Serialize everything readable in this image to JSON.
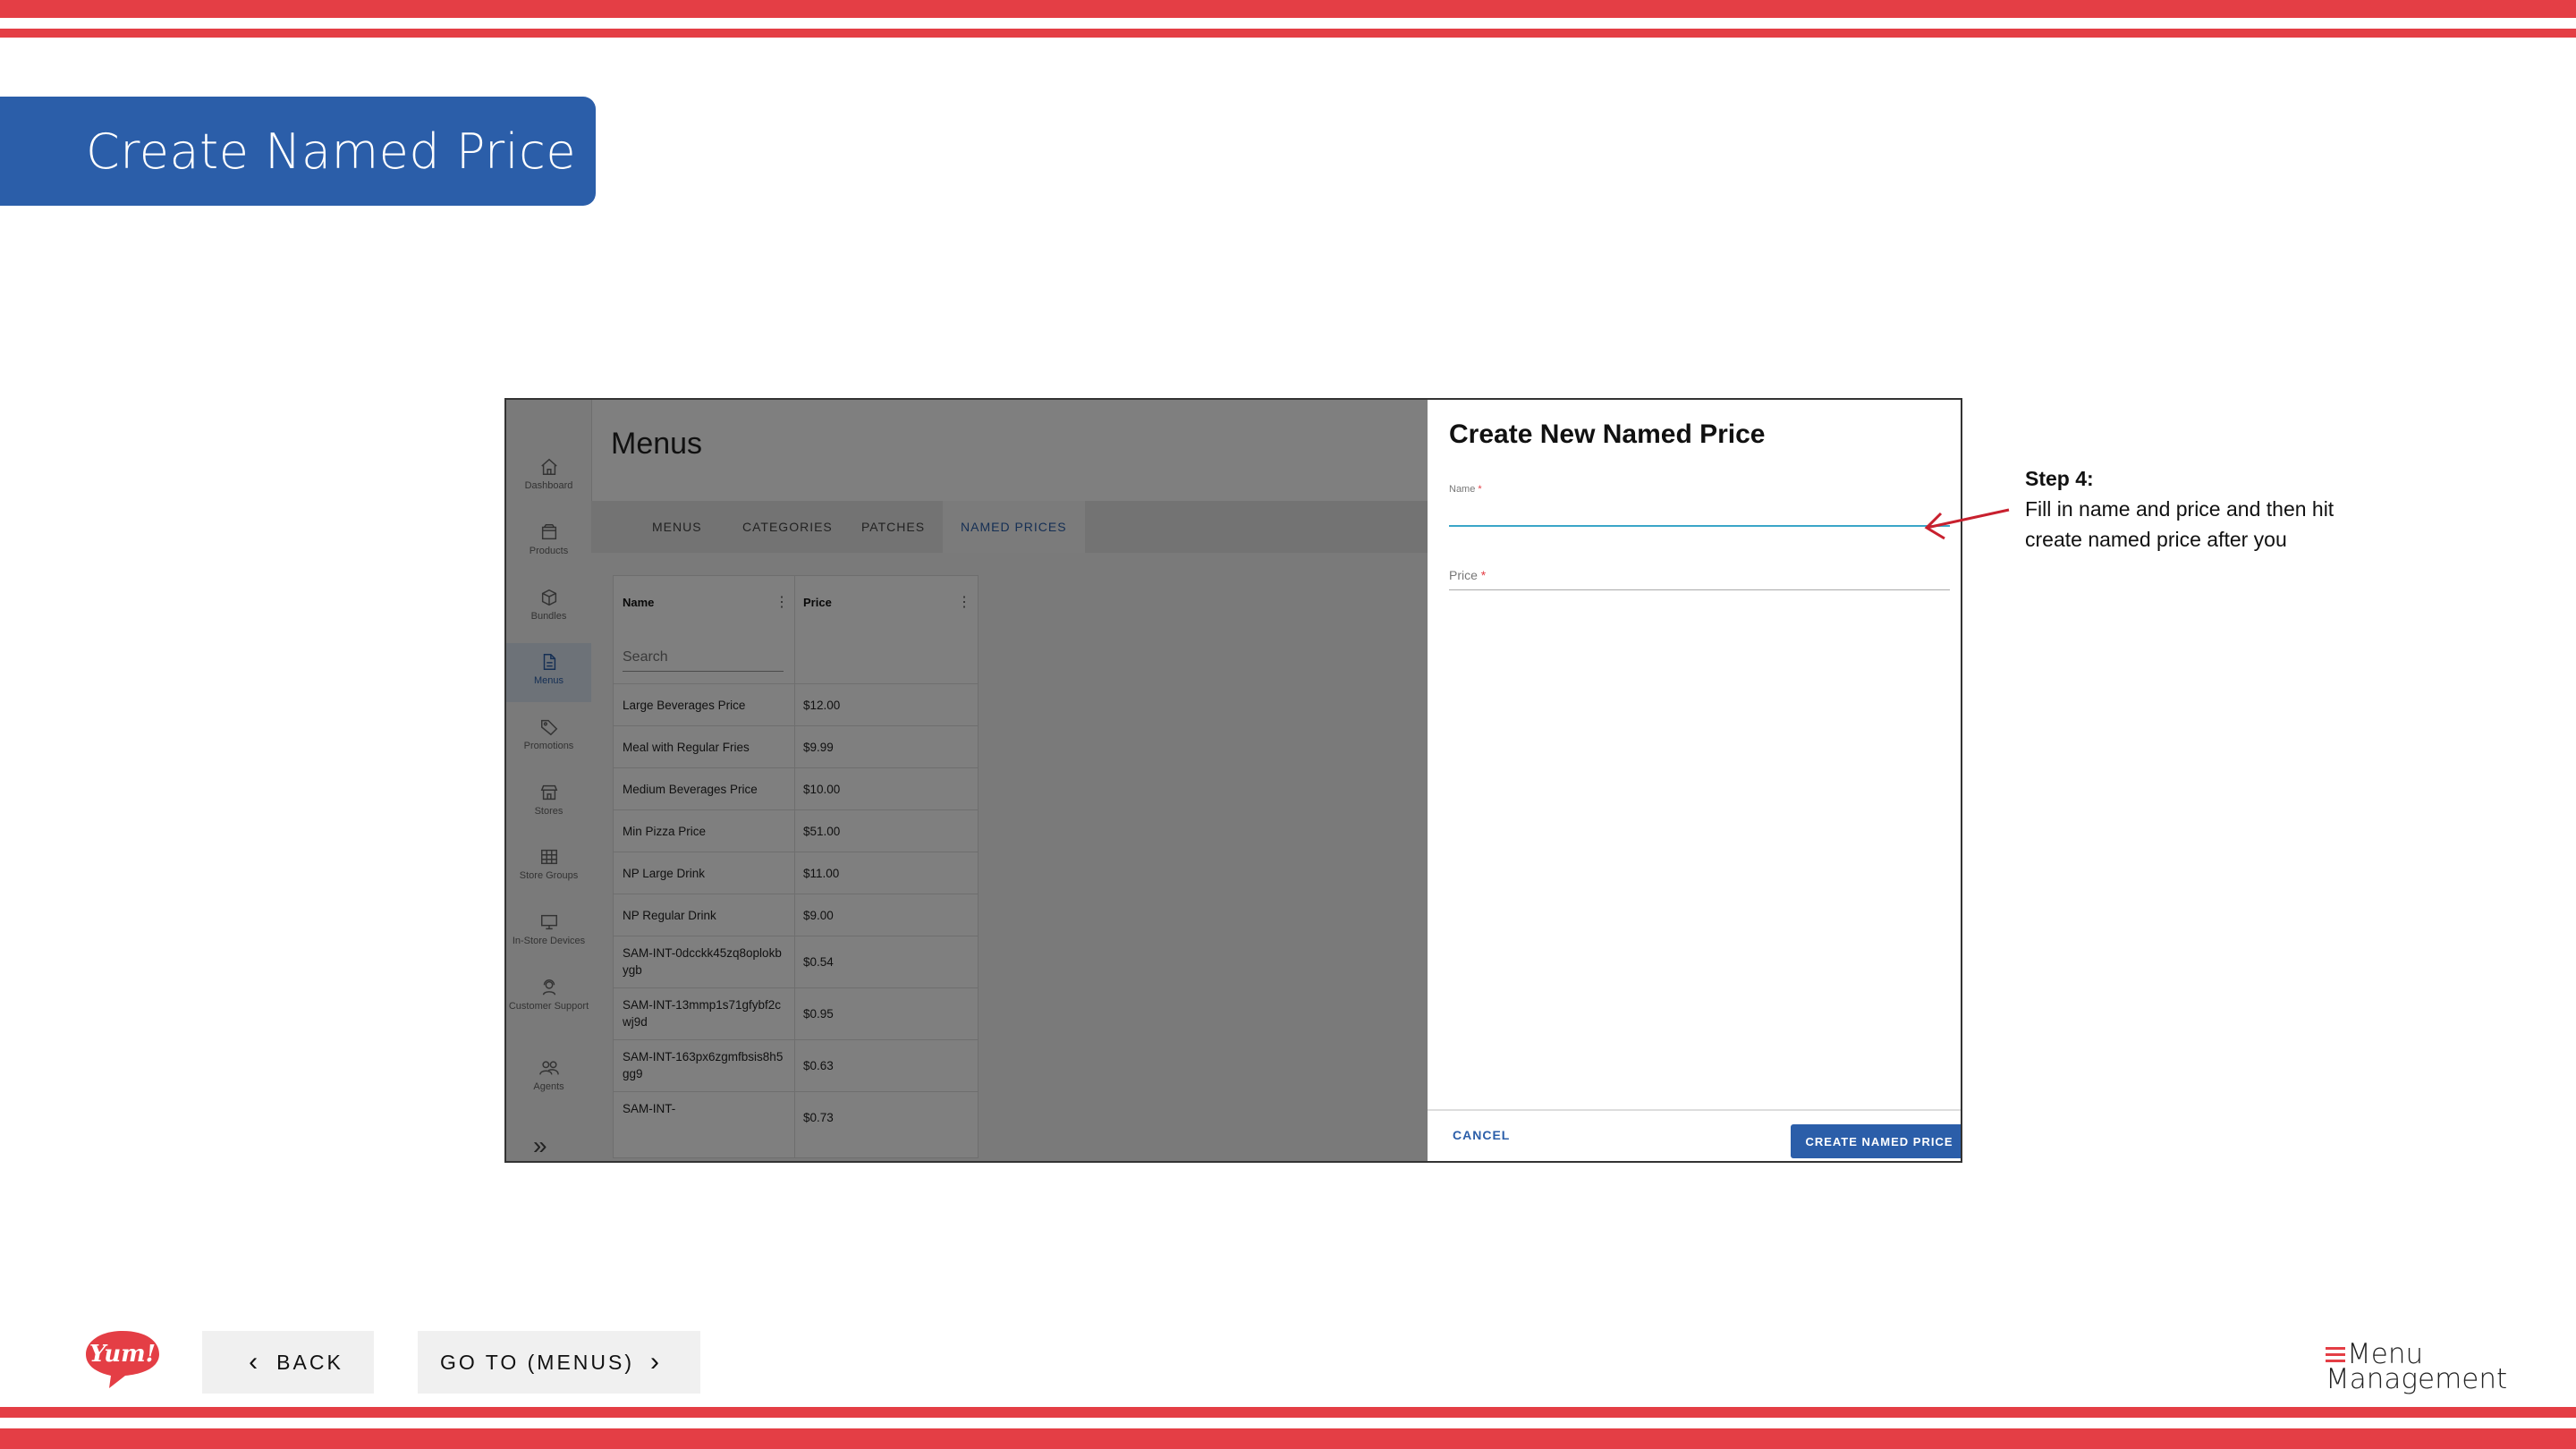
{
  "slide": {
    "title": "Create Named Price",
    "colors": {
      "accent_red": "#e43e45",
      "brand_blue": "#2b5ea9"
    }
  },
  "app": {
    "page_title": "Menus",
    "sidebar": {
      "items": [
        {
          "label": "Dashboard",
          "icon": "home-icon"
        },
        {
          "label": "Products",
          "icon": "box-icon"
        },
        {
          "label": "Bundles",
          "icon": "cube-icon"
        },
        {
          "label": "Menus",
          "icon": "document-icon"
        },
        {
          "label": "Promotions",
          "icon": "tag-icon"
        },
        {
          "label": "Stores",
          "icon": "storefront-icon"
        },
        {
          "label": "Store Groups",
          "icon": "grid-icon"
        },
        {
          "label": "In-Store Devices",
          "icon": "monitor-icon"
        },
        {
          "label": "Customer Support",
          "icon": "support-agent-icon"
        },
        {
          "label": "Agents",
          "icon": "people-icon"
        }
      ],
      "active": "Menus"
    },
    "tabs": [
      "MENUS",
      "CATEGORIES",
      "PATCHES",
      "NAMED PRICES"
    ],
    "active_tab": "NAMED PRICES",
    "grid": {
      "columns": [
        "Name",
        "Price"
      ],
      "search_placeholder": "Search",
      "rows": [
        {
          "name": "Large Beverages Price",
          "price": "$12.00"
        },
        {
          "name": "Meal with Regular Fries",
          "price": "$9.99"
        },
        {
          "name": "Medium Beverages Price",
          "price": "$10.00"
        },
        {
          "name": "Min Pizza Price",
          "price": "$51.00"
        },
        {
          "name": "NP Large Drink",
          "price": "$11.00"
        },
        {
          "name": "NP Regular Drink",
          "price": "$9.00"
        },
        {
          "name": "SAM-INT-0dcckk45zq8oplokbygb",
          "price": "$0.54"
        },
        {
          "name": "SAM-INT-13mmp1s71gfybf2cwj9d",
          "price": "$0.95"
        },
        {
          "name": "SAM-INT-163px6zgmfbsis8h5gg9",
          "price": "$0.63"
        },
        {
          "name": "SAM-INT-",
          "price": "$0.73"
        }
      ]
    },
    "panel": {
      "title": "Create New Named Price",
      "name_label": "Name",
      "price_label": "Price",
      "required_mark": "*",
      "name_value": "",
      "price_value": "",
      "cancel_label": "CANCEL",
      "create_label": "CREATE NAMED PRICE"
    }
  },
  "annotation": {
    "step": "Step 4:",
    "text": "Fill in name and price and then hit create named price after you"
  },
  "footer": {
    "back_label": "BACK",
    "goto_label": "GO TO (MENUS)",
    "yum_logo_text": "Yum!",
    "mm_logo_line1": "Menu",
    "mm_logo_line2": "Management"
  }
}
